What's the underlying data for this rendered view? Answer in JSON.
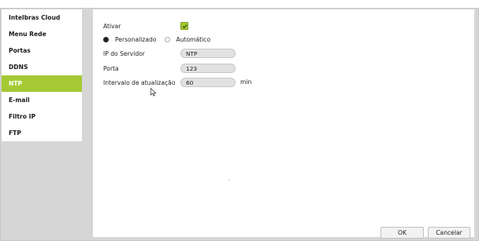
{
  "sidebar": {
    "items": [
      {
        "label": "Intelbras Cloud",
        "active": false
      },
      {
        "label": "Menu Rede",
        "active": false
      },
      {
        "label": "Portas",
        "active": false
      },
      {
        "label": "DDNS",
        "active": false
      },
      {
        "label": "NTP",
        "active": true
      },
      {
        "label": "E-mail",
        "active": false
      },
      {
        "label": "Filtro IP",
        "active": false
      },
      {
        "label": "FTP",
        "active": false
      }
    ]
  },
  "ntp": {
    "enable_label": "Ativar",
    "enabled": true,
    "mode_custom_label": "Personalizado",
    "mode_auto_label": "Automático",
    "mode_selected": "Personalizado",
    "server_label": "IP do Servidor",
    "server_value": "NTP",
    "port_label": "Porta",
    "port_value": "123",
    "interval_label": "Intervalo de atualização",
    "interval_value": "60",
    "interval_unit": "min"
  },
  "buttons": {
    "ok_label": "OK",
    "cancel_label": "Cancelar"
  },
  "colors": {
    "accent": "#a4c933",
    "panel_bg": "#d6d6d6"
  }
}
